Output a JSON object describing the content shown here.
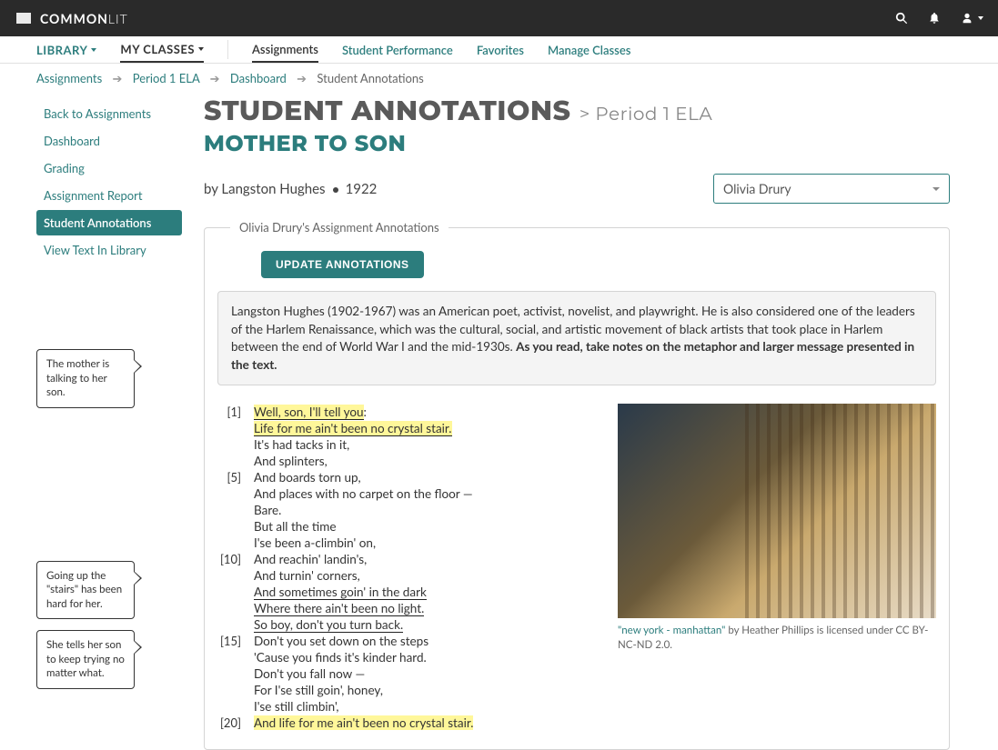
{
  "brand": {
    "bold": "COMMON",
    "thin": "LIT"
  },
  "nav2": {
    "library": "LIBRARY",
    "my_classes": "MY CLASSES",
    "assignments": "Assignments",
    "student_perf": "Student Performance",
    "favorites": "Favorites",
    "manage": "Manage Classes"
  },
  "breadcrumbs": {
    "a": "Assignments",
    "b": "Period 1 ELA",
    "c": "Dashboard",
    "d": "Student Annotations"
  },
  "sidebar": {
    "back": "Back to Assignments",
    "dash": "Dashboard",
    "grading": "Grading",
    "report": "Assignment Report",
    "annot": "Student Annotations",
    "view": "View Text In Library"
  },
  "page": {
    "title": "STUDENT ANNOTATIONS",
    "crumb": "> Period 1 ELA",
    "text_title": "MOTHER TO SON",
    "by": "by Langston Hughes",
    "year": "1922"
  },
  "student_select": {
    "value": "Olivia Drury"
  },
  "fieldset_legend": "Olivia Drury's Assignment Annotations",
  "update_btn": "UPDATE ANNOTATIONS",
  "intro": {
    "plain": "Langston Hughes (1902-1967) was an American poet, activist, novelist, and playwright. He is also considered one of the leaders of the Harlem Renaissance, which was the cultural, social, and artistic movement of black artists that took place in Harlem between the end of World War I and the mid-1930s. ",
    "bold": "As you read, take notes on the metaphor and larger message presented in the text."
  },
  "line_numbers": {
    "n1": "[1]",
    "n5": "[5]",
    "n10": "[10]",
    "n15": "[15]",
    "n20": "[20]"
  },
  "poem": {
    "l1a": "Well, son, I'll tell you",
    "l1b": ":",
    "l2": "Life for me ain't been no crystal stair.",
    "l3": "It's had tacks in it,",
    "l4": "And splinters,",
    "l5": "And boards torn up,",
    "l6": "And places with no carpet on the floor —",
    "l7": "Bare.",
    "l8": "But all the time",
    "l9": "I'se been a-climbin' on,",
    "l10": "And reachin' landin's,",
    "l11": "And turnin' corners,",
    "l12": "And sometimes goin' in the dark",
    "l13": "Where there ain't been no light.",
    "l14": "So boy, don't you turn back.",
    "l15": "Don't you set down on the steps",
    "l16": "'Cause you finds it's kinder hard.",
    "l17": "Don't you fall now —",
    "l18": "For I'se still goin', honey,",
    "l19": "I'se still climbin',",
    "l20": "And life for me ain't been no crystal stair."
  },
  "caption": {
    "link": "\"new york - manhattan\"",
    "rest": " by Heather Phillips is licensed under CC BY-NC-ND 2.0."
  },
  "notes": {
    "n1": "The mother is talking to her son.",
    "n2": "Going up the \"stairs\" has been hard for her.",
    "n3": "She tells her son to keep trying no matter what."
  }
}
